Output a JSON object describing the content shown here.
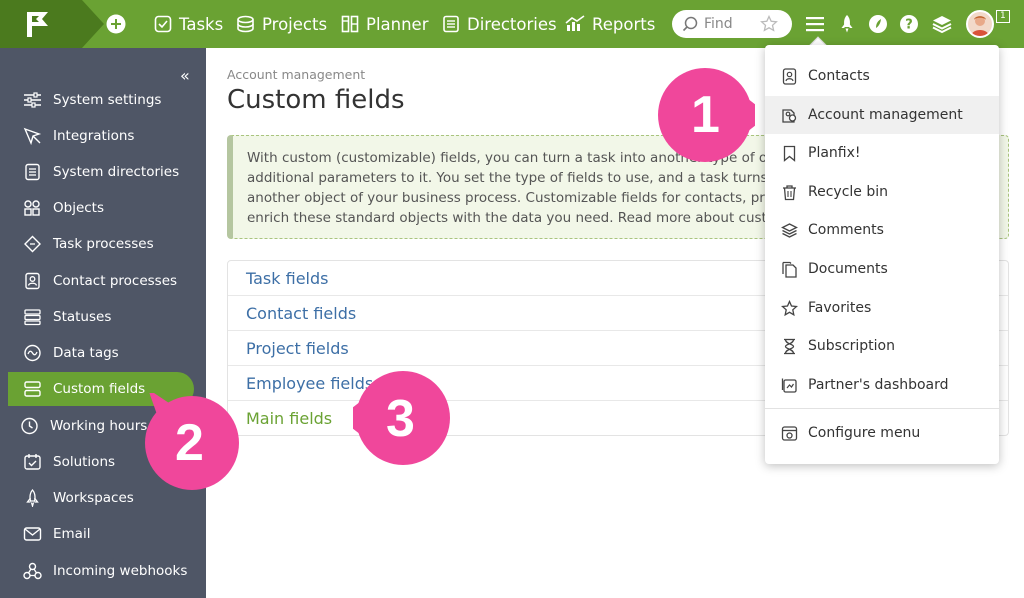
{
  "topbar": {
    "nav": [
      {
        "label": "Tasks",
        "icon": "tasks-icon"
      },
      {
        "label": "Projects",
        "icon": "projects-icon"
      },
      {
        "label": "Planner",
        "icon": "planner-icon"
      },
      {
        "label": "Directories",
        "icon": "directories-icon"
      },
      {
        "label": "Reports",
        "icon": "reports-icon"
      }
    ],
    "search_placeholder": "Find",
    "notification_count": "1",
    "accent": "#6aa233"
  },
  "sidebar": {
    "collapse_glyph": "«",
    "items": [
      {
        "label": "System settings",
        "icon": "sliders-icon"
      },
      {
        "label": "Integrations",
        "icon": "integrations-icon"
      },
      {
        "label": "System directories",
        "icon": "directory-icon"
      },
      {
        "label": "Objects",
        "icon": "objects-icon"
      },
      {
        "label": "Task processes",
        "icon": "process-icon"
      },
      {
        "label": "Contact processes",
        "icon": "contact-process-icon"
      },
      {
        "label": "Statuses",
        "icon": "statuses-icon"
      },
      {
        "label": "Data tags",
        "icon": "data-tags-icon"
      },
      {
        "label": "Custom fields",
        "icon": "custom-fields-icon",
        "active": true
      },
      {
        "label": "Working hours",
        "icon": "clock-icon"
      },
      {
        "label": "Solutions",
        "icon": "solutions-icon"
      },
      {
        "label": "Workspaces",
        "icon": "rocket-icon"
      },
      {
        "label": "Email",
        "icon": "email-icon"
      },
      {
        "label": "Incoming webhooks",
        "icon": "webhooks-icon"
      }
    ]
  },
  "main": {
    "breadcrumb": "Account management",
    "title": "Custom fields",
    "info_lines": [
      "With custom (customizable) fields, you can turn a task into another type of o",
      "additional parameters to it. You set the type of fields to use, and a task turns",
      "another object of your business process. Customizable fields for contacts, pro",
      "enrich these standard objects with the data you need. Read more about custo"
    ],
    "fields": [
      "Task fields",
      "Contact fields",
      "Project fields",
      "Employee fields",
      "Main fields"
    ]
  },
  "menu": {
    "items": [
      {
        "label": "Contacts",
        "icon": "contacts-icon"
      },
      {
        "label": "Account management",
        "icon": "account-management-icon",
        "highlighted": true
      },
      {
        "label": "Planfix!",
        "icon": "bookmark-icon"
      },
      {
        "label": "Recycle bin",
        "icon": "trash-icon"
      },
      {
        "label": "Comments",
        "icon": "comments-icon"
      },
      {
        "label": "Documents",
        "icon": "documents-icon"
      },
      {
        "label": "Favorites",
        "icon": "star-icon"
      },
      {
        "label": "Subscription",
        "icon": "hourglass-icon"
      },
      {
        "label": "Partner's dashboard",
        "icon": "dashboard-icon"
      }
    ],
    "configure": {
      "label": "Configure menu",
      "icon": "configure-icon"
    }
  },
  "callouts": [
    "1",
    "2",
    "3"
  ],
  "callout_color": "#f0479b"
}
